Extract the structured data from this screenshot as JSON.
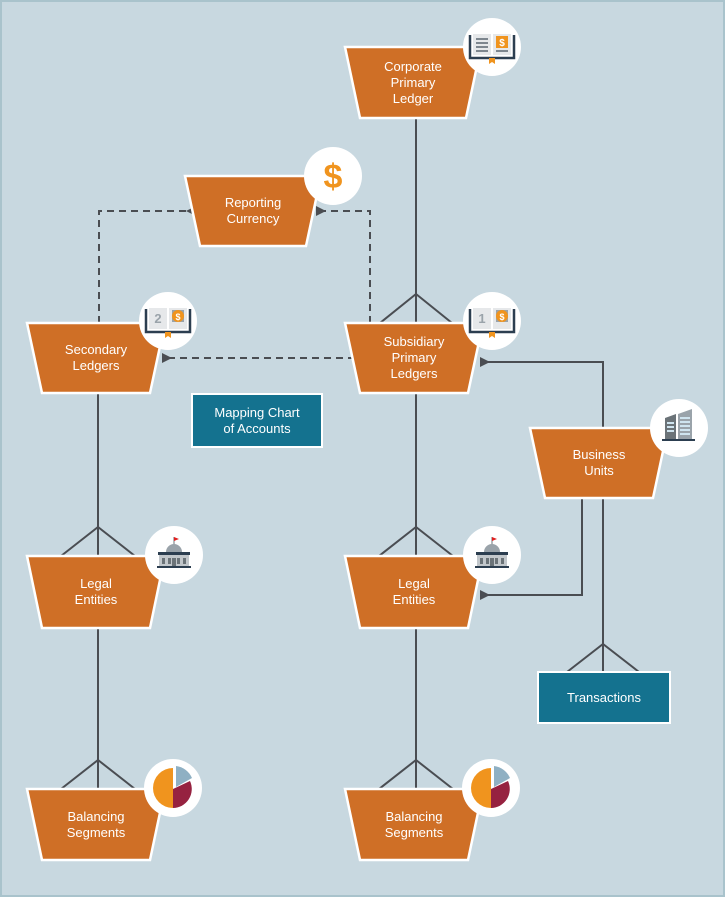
{
  "diagram": {
    "colors": {
      "background": "#c8d8e0",
      "node_fill": "#cf6f26",
      "box_fill": "#14728f",
      "connector": "#4a4d52",
      "icon_dark": "#2c3e50",
      "icon_orange": "#f0941e",
      "pie_blue": "#8fb0c3",
      "pie_red": "#962240"
    },
    "nodes": {
      "corporate_primary_ledger": {
        "label": "Corporate\nPrimary\nLedger",
        "icon": "open-book-dollar-icon"
      },
      "reporting_currency": {
        "label": "Reporting\nCurrency",
        "icon": "dollar-sign-icon"
      },
      "secondary_ledgers": {
        "label": "Secondary\nLedgers",
        "icon": "book-2-dollar-icon",
        "icon_number": "2"
      },
      "subsidiary_primary_ledgers": {
        "label": "Subsidiary\nPrimary\nLedgers",
        "icon": "book-1-dollar-icon",
        "icon_number": "1"
      },
      "business_units": {
        "label": "Business\nUnits",
        "icon": "office-buildings-icon"
      },
      "legal_entities_left": {
        "label": "Legal\nEntities",
        "icon": "government-building-icon"
      },
      "legal_entities_right": {
        "label": "Legal\nEntities",
        "icon": "government-building-icon"
      },
      "balancing_segments_left": {
        "label": "Balancing\nSegments",
        "icon": "pie-chart-icon"
      },
      "balancing_segments_right": {
        "label": "Balancing\nSegments",
        "icon": "pie-chart-icon"
      }
    },
    "boxes": {
      "mapping_chart": {
        "label": "Mapping Chart\nof Accounts"
      },
      "transactions": {
        "label": "Transactions"
      }
    }
  }
}
